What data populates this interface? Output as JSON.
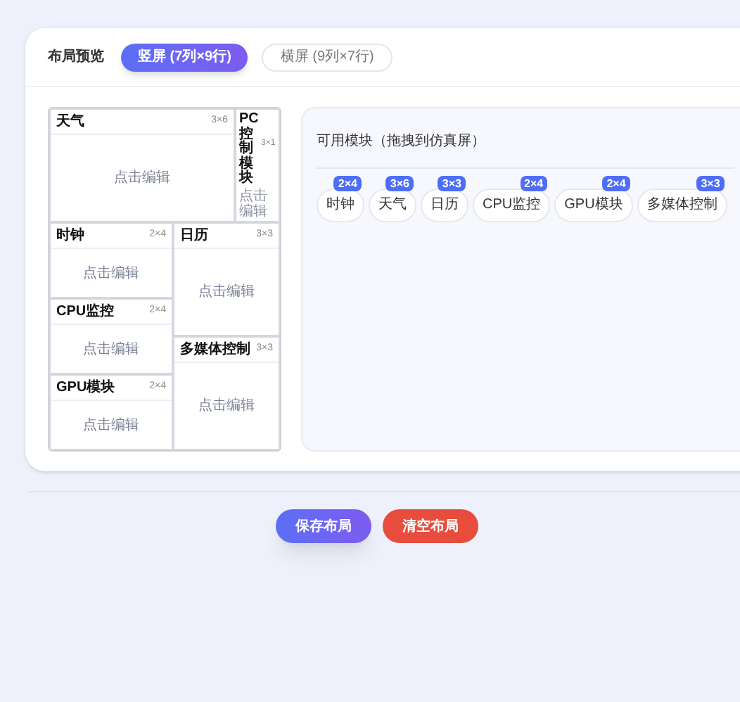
{
  "header": {
    "label": "布局预览",
    "tabs": [
      {
        "label": "竖屏 (7列×9行)",
        "selected": true
      },
      {
        "label": "横屏 (9列×7行)",
        "selected": false
      }
    ]
  },
  "preview": {
    "cells": [
      {
        "title": "天气",
        "size": "3×6",
        "hint": "点击编辑",
        "kind": "wide"
      },
      {
        "title": "PC控制模块",
        "size": "3×1",
        "hint": "点击编辑",
        "kind": "narrow"
      },
      {
        "title": "时钟",
        "size": "2×4",
        "hint": "点击编辑",
        "kind": "wide"
      },
      {
        "title": "日历",
        "size": "3×3",
        "hint": "点击编辑",
        "kind": "wide"
      },
      {
        "title": "CPU监控",
        "size": "2×4",
        "hint": "点击编辑",
        "kind": "wide"
      },
      {
        "title": "多媒体控制",
        "size": "3×3",
        "hint": "点击编辑",
        "kind": "wide"
      },
      {
        "title": "GPU模块",
        "size": "2×4",
        "hint": "点击编辑",
        "kind": "wide"
      }
    ]
  },
  "modules": {
    "title": "可用模块（拖拽到仿真屏）",
    "items": [
      {
        "label": "时钟",
        "size": "2×4"
      },
      {
        "label": "天气",
        "size": "3×6"
      },
      {
        "label": "日历",
        "size": "3×3"
      },
      {
        "label": "CPU监控",
        "size": "2×4"
      },
      {
        "label": "GPU模块",
        "size": "2×4"
      },
      {
        "label": "多媒体控制",
        "size": "3×3"
      }
    ]
  },
  "buttons": [
    {
      "label": "保存布局",
      "kind": "primary"
    },
    {
      "label": "清空布局",
      "kind": "danger"
    }
  ]
}
